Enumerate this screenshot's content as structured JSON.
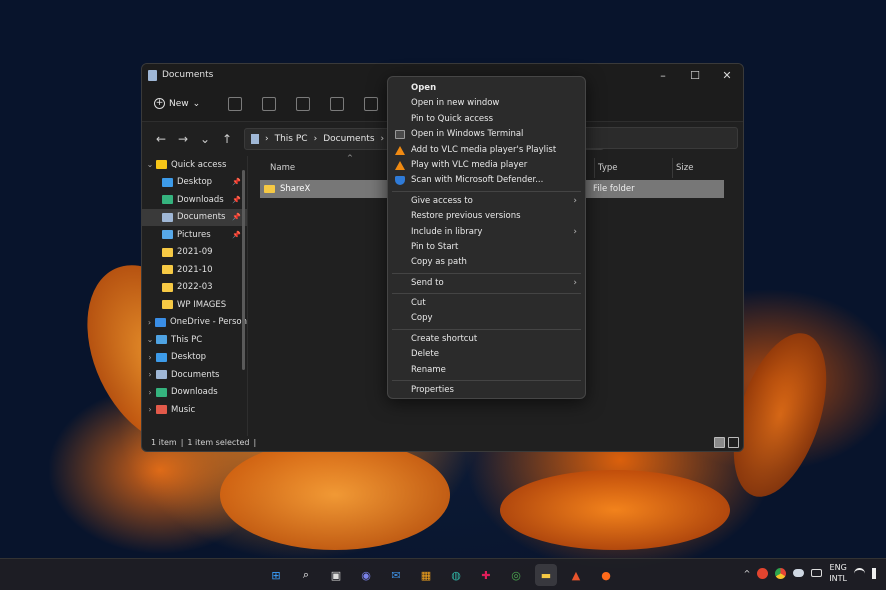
{
  "window": {
    "title": "Documents",
    "controls": {
      "minimize": "–",
      "maximize": "☐",
      "close": "✕"
    }
  },
  "toolbar": {
    "new_label": "New",
    "new_chevron": "⌄",
    "icons": [
      "cut-icon",
      "copy-icon",
      "paste-icon",
      "rename-icon",
      "share-icon",
      "delete-icon"
    ]
  },
  "address": {
    "back": "←",
    "forward": "→",
    "recent": "⌄",
    "up": "↑",
    "crumbs": [
      "This PC",
      "Documents"
    ],
    "separator": "›",
    "search_placeholder": "nts"
  },
  "sidebar": {
    "items": [
      {
        "label": "Quick access",
        "chev": "⌄",
        "icon": "star-icon",
        "color": "#f5c518"
      },
      {
        "label": "Desktop",
        "icon": "desktop-icon",
        "color": "#3d9be9",
        "pin": "📌"
      },
      {
        "label": "Downloads",
        "icon": "download-icon",
        "color": "#35b37e",
        "pin": "📌"
      },
      {
        "label": "Documents",
        "icon": "document-icon",
        "color": "#9fb7d6",
        "pin": "📌",
        "selected": true
      },
      {
        "label": "Pictures",
        "icon": "pictures-icon",
        "color": "#57a8e8",
        "pin": "📌"
      },
      {
        "label": "2021-09",
        "icon": "folder-icon",
        "color": "#f6c944"
      },
      {
        "label": "2021-10",
        "icon": "folder-icon",
        "color": "#f6c944"
      },
      {
        "label": "2022-03",
        "icon": "folder-icon",
        "color": "#f6c944"
      },
      {
        "label": "WP IMAGES",
        "icon": "folder-icon",
        "color": "#f6c944"
      },
      {
        "label": "OneDrive - Person",
        "chev": "›",
        "icon": "cloud-icon",
        "color": "#3a8ee6"
      },
      {
        "label": "This PC",
        "chev": "⌄",
        "icon": "pc-icon",
        "color": "#4fa3e3"
      },
      {
        "label": "Desktop",
        "chev": "›",
        "icon": "desktop-icon",
        "color": "#3d9be9"
      },
      {
        "label": "Documents",
        "chev": "›",
        "icon": "document-icon",
        "color": "#9fb7d6"
      },
      {
        "label": "Downloads",
        "chev": "›",
        "icon": "download-icon",
        "color": "#35b37e"
      },
      {
        "label": "Music",
        "chev": "›",
        "icon": "music-icon",
        "color": "#e35a4a"
      }
    ]
  },
  "content": {
    "columns": {
      "name": "Name",
      "type": "Type",
      "size": "Size"
    },
    "sort_arrow": "^",
    "rows": [
      {
        "name": "ShareX",
        "type": "File folder"
      }
    ]
  },
  "status": {
    "count": "1 item",
    "divider": "|",
    "selected": "1 item selected"
  },
  "context_menu": {
    "groups": [
      [
        {
          "label": "Open",
          "bold": true
        },
        {
          "label": "Open in new window"
        },
        {
          "label": "Pin to Quick access"
        },
        {
          "label": "Open in Windows Terminal",
          "icon": "terminal-icon"
        },
        {
          "label": "Add to VLC media player's Playlist",
          "icon": "vlc-icon"
        },
        {
          "label": "Play with VLC media player",
          "icon": "vlc-icon"
        },
        {
          "label": "Scan with Microsoft Defender...",
          "icon": "defender-shield-icon"
        }
      ],
      [
        {
          "label": "Give access to",
          "submenu": true
        },
        {
          "label": "Restore previous versions"
        },
        {
          "label": "Include in library",
          "submenu": true
        },
        {
          "label": "Pin to Start"
        },
        {
          "label": "Copy as path"
        }
      ],
      [
        {
          "label": "Send to",
          "submenu": true
        }
      ],
      [
        {
          "label": "Cut"
        },
        {
          "label": "Copy"
        }
      ],
      [
        {
          "label": "Create shortcut"
        },
        {
          "label": "Delete"
        },
        {
          "label": "Rename"
        }
      ],
      [
        {
          "label": "Properties"
        }
      ]
    ],
    "submenu_arrow": "›"
  },
  "taskbar": {
    "icons": [
      {
        "name": "start-icon",
        "glyph": "⊞",
        "color": "#3aa0ff"
      },
      {
        "name": "search-icon",
        "glyph": "⌕",
        "color": "#ffffff"
      },
      {
        "name": "task-view-icon",
        "glyph": "▣",
        "color": "#dddddd"
      },
      {
        "name": "chat-icon",
        "glyph": "◉",
        "color": "#7b83eb"
      },
      {
        "name": "mail-icon",
        "glyph": "✉",
        "color": "#3d8fe0"
      },
      {
        "name": "store-icon",
        "glyph": "▦",
        "color": "#f3a21b"
      },
      {
        "name": "edge-icon",
        "glyph": "◍",
        "color": "#2fb3a5"
      },
      {
        "name": "slack-icon",
        "glyph": "✚",
        "color": "#e01e5a"
      },
      {
        "name": "chrome-icon",
        "glyph": "◎",
        "color": "#4caf50"
      },
      {
        "name": "file-explorer-icon",
        "glyph": "▬",
        "color": "#f6c944",
        "active": true
      },
      {
        "name": "app-icon",
        "glyph": "▲",
        "color": "#e8542c"
      },
      {
        "name": "firefox-icon",
        "glyph": "●",
        "color": "#ff6a1a"
      }
    ],
    "tray": {
      "chevron": "^",
      "lang_top": "ENG",
      "lang_bottom": "INTL",
      "icons": [
        "creative-cloud-icon",
        "chrome-tray-icon",
        "onedrive-icon",
        "keyboard-icon",
        "wifi-icon",
        "volume-icon"
      ]
    }
  }
}
